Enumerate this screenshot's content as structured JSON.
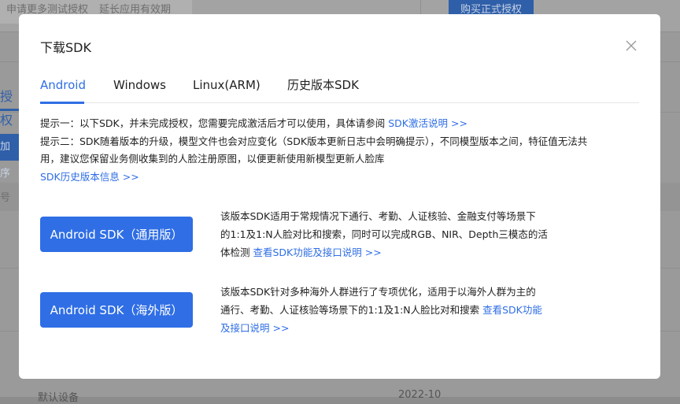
{
  "background": {
    "chip1": "申请更多测试授权",
    "chip2": "延长应用有效期",
    "buy_button": "购买正式授权",
    "tab_fragment": "授权",
    "button_fragment": "加序",
    "header_fragment": "号",
    "footer_left": "默认设备",
    "footer_right": "2022-10"
  },
  "modal": {
    "title": "下载SDK",
    "tabs": [
      {
        "label": "Android"
      },
      {
        "label": "Windows"
      },
      {
        "label": "Linux(ARM)"
      },
      {
        "label": "历史版本SDK"
      }
    ],
    "notes": {
      "line1": "提示一：以下SDK，并未完成授权，您需要完成激活后才可以使用，具体请参阅 ",
      "line1_link": "SDK激活说明 >>",
      "line2": "提示二：SDK随着版本的升级，模型文件也会对应变化（SDK版本更新日志中会明确提示），不同模型版本之间，特征值无法共",
      "line3": "用，建议您保留业务侧收集到的人脸注册原图，以便更新使用新模型更新人脸库",
      "history_link": "SDK历史版本信息 >>"
    },
    "sdks": [
      {
        "button": "Android SDK（通用版）",
        "line1": "该版本SDK适用于常规情况下通行、考勤、人证核验、金融支付等场景下",
        "line2": "的1:1及1:N人脸对比和搜索，同时可以完成RGB、NIR、Depth三模态的活",
        "line3": "体检测 ",
        "link": "查看SDK功能及接口说明 >>"
      },
      {
        "button": "Android SDK（海外版）",
        "line1": "该版本SDK针对多种海外人群进行了专项优化，适用于以海外人群为主的",
        "line2": "通行、考勤、人证核验等场景下的1:1及1:N人脸比对和搜索 ",
        "link_part1": "查看SDK功能",
        "link_part2": "及接口说明 >>"
      }
    ]
  },
  "colors": {
    "accent": "#2f6ee5",
    "overlay": "#9a9a9a"
  }
}
